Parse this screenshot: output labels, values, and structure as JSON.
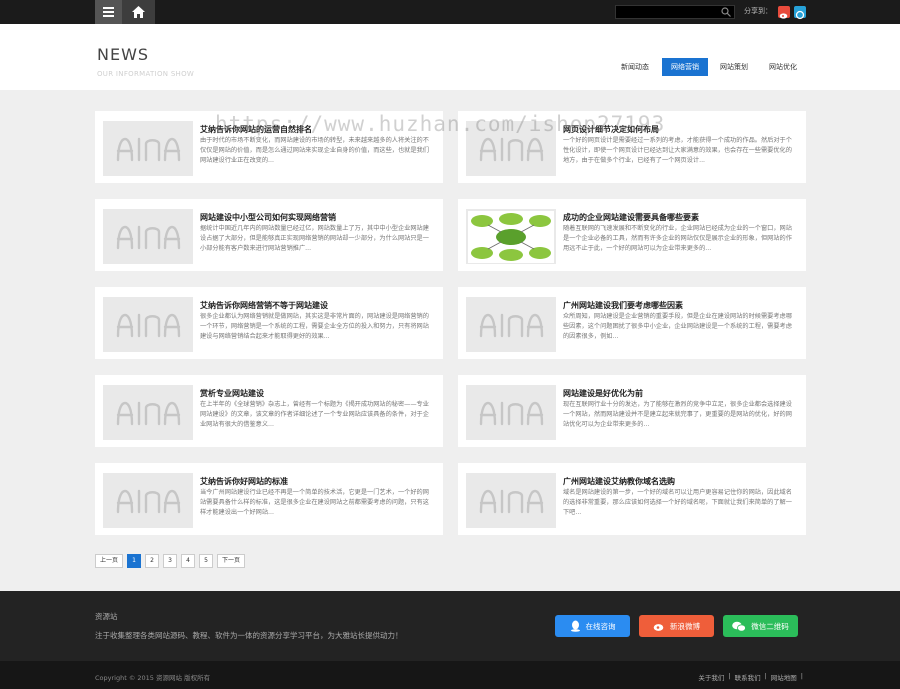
{
  "topbar": {
    "share_label": "分享到："
  },
  "header": {
    "title": "NEWS",
    "subtitle": "OUR INFORMATION SHOW",
    "tabs": [
      {
        "label": "新闻动态"
      },
      {
        "label": "网络营销"
      },
      {
        "label": "网站策划"
      },
      {
        "label": "网站优化"
      }
    ]
  },
  "cards": [
    {
      "title": "艾纳告诉你网站的运营自然排名",
      "desc": "由于时代的市场不断变化，而网站建设的市场的转型，未来越来越多的人将关注的不仅仅是网站的价值，而是怎么通过网站来实现企业自身的价值，而这些，也就是我们网站建设行业正在改变的..."
    },
    {
      "title": "网页设计细节决定如何布局",
      "desc": "一个好的网页设计是需要经过一系列的考虑，才能获得一个成功的作品。然后对于个性化设计，即使一个网页设计已经达到让大家满意的效果，也会存在一些需要优化的地方，由于在做多个行业，已经有了一个网页设计..."
    },
    {
      "title": "网站建设中小型公司如何实现网络营销",
      "desc": "据统计中国近几年内的网站数量已经过亿，网站数量上了万，其中中小型企业网站建设占据了大部分，但是能够真正实现网络营销的网站却一少部分，为什么网站只是一小部分能有客户数来进行网站营销推广..."
    },
    {
      "title": "成功的企业网站建设需要具备哪些要素",
      "desc": "随着互联网的飞速发展和不断变化的行业，企业网站已经成为企业的一个窗口，网站是一个企业必备的工具，然而有许多企业的网站仅仅是展示企业的形象，但网站的作用远不止于此，一个好的网站可以为企业带来更多的..."
    },
    {
      "title": "艾纳告诉你网络营销不等于网站建设",
      "desc": "很多企业都认为网络营销就是做网站，其实这是非常片面的，网站建设是网络营销的一个环节，网络营销是一个系统的工程，需要企业全方位的投入和努力，只有将网站建设与网络营销结合起来才能取得更好的效果..."
    },
    {
      "title": "广州网站建设我们要考虑哪些因素",
      "desc": "众所周知，网站建设是企业营销的重要手段，但是企业在建设网站的时候需要考虑哪些因素，这个问题困扰了很多中小企业，企业网站建设是一个系统的工程，需要考虑的因素很多，例如..."
    },
    {
      "title": "赏析专业网站建设",
      "desc": "在上半年的《全球营销》杂志上，曾经有一个标题为《揭开成功网站的秘密——专业网站建设》的文章，该文章的作者详细论述了一个专业网站应该具备的条件，对于企业网站有很大的借鉴意义..."
    },
    {
      "title": "网站建设是好优化为前",
      "desc": "现在互联网行业十分的发达，为了能够在激烈的竞争中立足，很多企业都会选择建设一个网站，然而网站建设并不是建立起来就完事了，更重要的是网站的优化，好的网站优化可以为企业带来更多的..."
    },
    {
      "title": "艾纳告诉你好网站的标准",
      "desc": "当今广州网站建设行业已经不再是一个简单的技术活，它更是一门艺术，一个好的网站需要具备什么样的标准，这是很多企业在建设网站之前都需要考虑的问题，只有这样才能建设出一个好网站..."
    },
    {
      "title": "广州网站建设艾纳教你域名选购",
      "desc": "域名是网站建设的第一步，一个好的域名可以让用户更容易记住你的网站，因此域名的选择非常重要，那么应该如何选择一个好的域名呢，下面就让我们来简单的了解一下吧..."
    }
  ],
  "pager": {
    "prev": "上一页",
    "pages": [
      "1",
      "2",
      "3",
      "4",
      "5"
    ],
    "next": "下一页"
  },
  "footer": {
    "title": "资源站",
    "desc": "注于收集整理各类网站源码、教程、软件为一体的资源分享学习平台，为大雅站长提供动力！",
    "btn_qq": "在线咨询",
    "btn_weibo": "新浪微博",
    "btn_wechat": "微信二维码"
  },
  "bottom": {
    "copyright": "Copyright © 2015 资源网站 版权所有",
    "links": [
      "关于我们",
      "|",
      "联系我们",
      "|",
      "网站地图",
      "|"
    ]
  },
  "watermark": "https://www.huzhan.com/ishop27193",
  "colors": {
    "accent": "#1a73d1",
    "qq": "#2b8cf1",
    "weibo": "#ef5e3a",
    "wechat": "#2bbd5a"
  }
}
